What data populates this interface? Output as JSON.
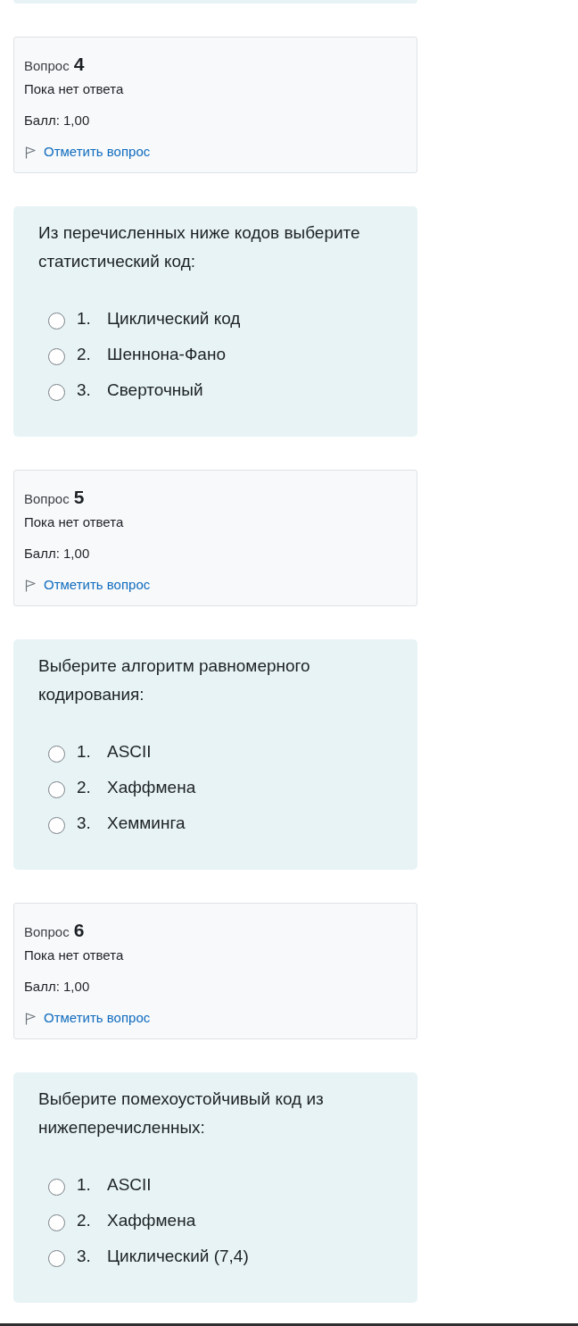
{
  "questions": [
    {
      "label": "Вопрос",
      "number": "4",
      "status": "Пока нет ответа",
      "grade": "Балл: 1,00",
      "flag_link": "Отметить вопрос",
      "flagged": false,
      "text": "Из перечисленных ниже кодов выберите статистический код:",
      "options": [
        {
          "number": "1.",
          "label": "Циклический код",
          "selected": false
        },
        {
          "number": "2.",
          "label": "Шеннона-Фано",
          "selected": false
        },
        {
          "number": "3.",
          "label": "Сверточный",
          "selected": false
        }
      ]
    },
    {
      "label": "Вопрос",
      "number": "5",
      "status": "Пока нет ответа",
      "grade": "Балл: 1,00",
      "flag_link": "Отметить вопрос",
      "flagged": false,
      "text": "Выберите алгоритм равномерного кодирования:",
      "options": [
        {
          "number": "1.",
          "label": "ASCII",
          "selected": false
        },
        {
          "number": "2.",
          "label": "Хаффмена",
          "selected": false
        },
        {
          "number": "3.",
          "label": "Хемминга",
          "selected": false
        }
      ]
    },
    {
      "label": "Вопрос",
      "number": "6",
      "status": "Пока нет ответа",
      "grade": "Балл: 1,00",
      "flag_link": "Отметить вопрос",
      "flagged": false,
      "text": "Выберите помехоустойчивый код из нижеперечисленных:",
      "options": [
        {
          "number": "1.",
          "label": "ASCII",
          "selected": false
        },
        {
          "number": "2.",
          "label": "Хаффмена",
          "selected": false
        },
        {
          "number": "3.",
          "label": "Циклический (7,4)",
          "selected": false
        }
      ]
    }
  ]
}
